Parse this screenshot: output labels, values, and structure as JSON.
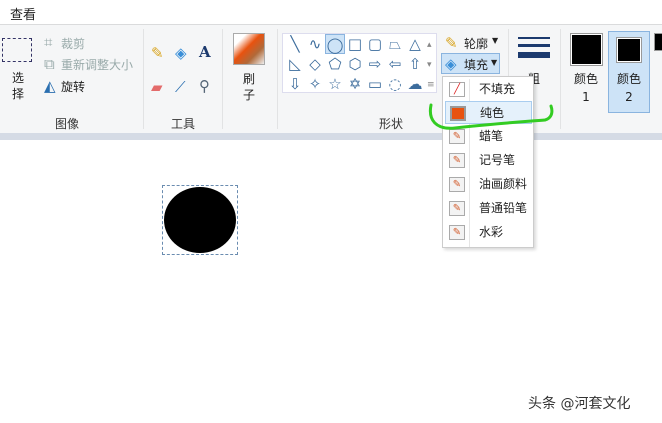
{
  "tabs": {
    "view": "查看"
  },
  "image_group": {
    "select": "选择",
    "crop": "裁剪",
    "resize": "重新调整大小",
    "rotate": "旋转",
    "label": "图像"
  },
  "tools_group": {
    "label": "工具"
  },
  "brush_group": {
    "label": "刷子"
  },
  "shapes_group": {
    "label": "形状",
    "outline": "轮廓",
    "fill": "填充"
  },
  "size_group": {
    "label": "粗"
  },
  "colors": {
    "color1": "颜色 1",
    "color2": "颜色 2",
    "color1_hex": "#000000",
    "color2_hex": "#000000"
  },
  "fill_menu": {
    "items": [
      "不填充",
      "纯色",
      "蜡笔",
      "记号笔",
      "油画颜料",
      "普通铅笔",
      "水彩"
    ],
    "selected": "纯色"
  },
  "watermark": "头条 @河套文化"
}
